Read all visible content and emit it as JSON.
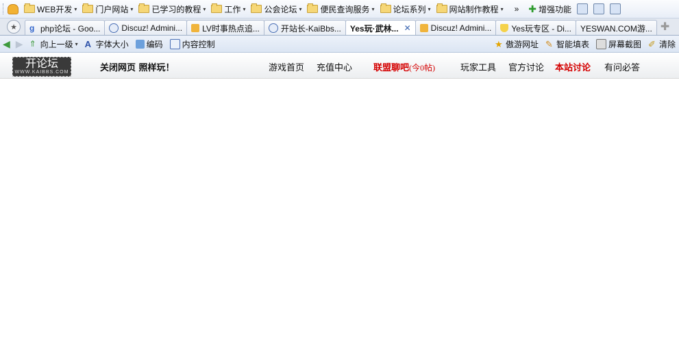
{
  "favorites_bar": {
    "folders": [
      {
        "label": "WEB开发"
      },
      {
        "label": "门户网站"
      },
      {
        "label": "已学习的教程"
      },
      {
        "label": "工作"
      },
      {
        "label": "公会论坛"
      },
      {
        "label": "便民查询服务"
      },
      {
        "label": "论坛系列"
      },
      {
        "label": "网站制作教程"
      }
    ],
    "overflow": "»",
    "enhance_label": "增强功能"
  },
  "tabs": [
    {
      "label": "php论坛 - Goo...",
      "icon": "google-icon",
      "active": false
    },
    {
      "label": "Discuz! Admini...",
      "icon": "discuz-icon",
      "active": false
    },
    {
      "label": "LV时事热点追...",
      "icon": "pma-icon",
      "active": false
    },
    {
      "label": "开站长-KaiBbs...",
      "icon": "discuz-icon",
      "active": false
    },
    {
      "label": "Yes玩·武林...",
      "icon": "page-icon",
      "active": true
    },
    {
      "label": "Discuz! Admini...",
      "icon": "pma-icon",
      "active": false
    },
    {
      "label": "Yes玩专区 - Di...",
      "icon": "trophy-icon",
      "active": false
    },
    {
      "label": "YESWAN.COM游...",
      "icon": "none",
      "active": false
    }
  ],
  "close_glyph": "✕",
  "command_bar": {
    "up_level": "向上一级",
    "font_size": "字体大小",
    "encoding": "编码",
    "content_control": "内容控制",
    "aoyou_sites": "傲游网址",
    "smart_fill": "智能填表",
    "screenshot": "屏幕截图",
    "clear": "清除"
  },
  "site": {
    "logo_main": "开论坛",
    "logo_sub": "WWW.KAIBBS.COM",
    "slogan": "关闭网页  照样玩！",
    "nav": [
      {
        "label": "游戏首页"
      },
      {
        "label": "充值中心"
      },
      {
        "label": "联盟聊吧",
        "count": "(今0帖)"
      },
      {
        "label": "玩家工具"
      },
      {
        "label": "官方讨论"
      },
      {
        "label": "本站讨论"
      },
      {
        "label": "有问必答"
      }
    ]
  }
}
